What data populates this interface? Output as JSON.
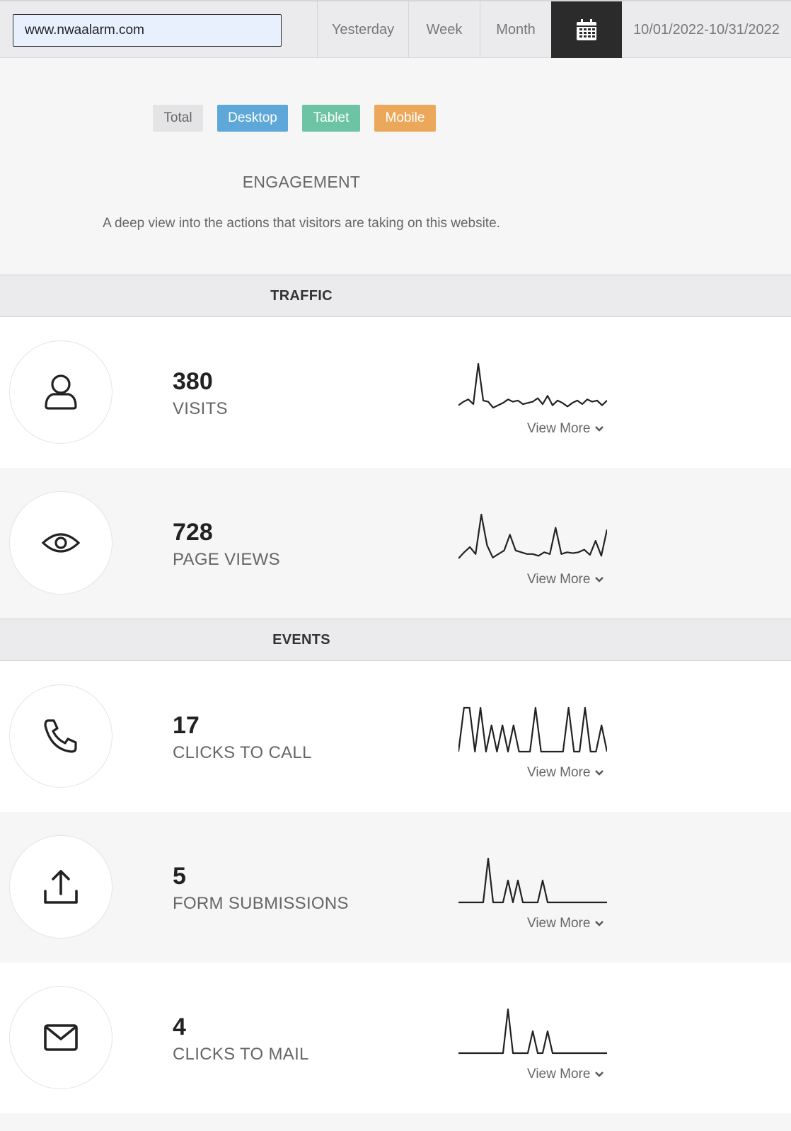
{
  "toolbar": {
    "site": "www.nwaalarm.com",
    "ranges": [
      "Yesterday",
      "Week",
      "Month"
    ],
    "date_range": "10/01/2022-10/31/2022"
  },
  "filters": [
    {
      "label": "Total",
      "bg": "#e4e4e6",
      "fg": "#666666"
    },
    {
      "label": "Desktop",
      "bg": "#5ea8d9",
      "fg": "#ffffff"
    },
    {
      "label": "Tablet",
      "bg": "#6cc4a4",
      "fg": "#ffffff"
    },
    {
      "label": "Mobile",
      "bg": "#eba85a",
      "fg": "#ffffff"
    }
  ],
  "engagement": {
    "title": "ENGAGEMENT",
    "description": "A deep view into the actions that visitors are taking on this website."
  },
  "sections": {
    "traffic": "TRAFFIC",
    "events": "EVENTS"
  },
  "metrics": {
    "visits": {
      "value": "380",
      "label": "VISITS",
      "icon": "user-icon",
      "series": [
        5,
        8,
        10,
        6,
        40,
        9,
        8,
        3,
        5,
        7,
        10,
        8,
        9,
        6,
        7,
        8,
        11,
        6,
        13,
        5,
        9,
        7,
        4,
        7,
        9,
        6,
        10,
        8,
        9,
        5,
        9
      ]
    },
    "pageviews": {
      "value": "728",
      "label": "PAGE VIEWS",
      "icon": "eye-icon",
      "series": [
        5,
        12,
        18,
        10,
        55,
        20,
        6,
        10,
        14,
        32,
        14,
        12,
        10,
        10,
        8,
        12,
        10,
        40,
        10,
        12,
        11,
        12,
        15,
        9,
        25,
        8,
        38
      ]
    },
    "calls": {
      "value": "17",
      "label": "CLICKS TO CALL",
      "icon": "phone-icon",
      "series": [
        0,
        1,
        1,
        0,
        1,
        0,
        0.6,
        0,
        0.6,
        0,
        0.6,
        0,
        0,
        0,
        1,
        0,
        0,
        0,
        0,
        0,
        1,
        0,
        0,
        1,
        0,
        0,
        0.6,
        0
      ]
    },
    "forms": {
      "value": "5",
      "label": "FORM SUBMISSIONS",
      "icon": "upload-icon",
      "series": [
        0,
        0,
        0,
        0,
        0,
        0,
        1,
        0,
        0,
        0,
        0.5,
        0,
        0.5,
        0,
        0,
        0,
        0,
        0.5,
        0,
        0,
        0,
        0,
        0,
        0,
        0,
        0,
        0,
        0,
        0,
        0,
        0
      ]
    },
    "mail": {
      "value": "4",
      "label": "CLICKS TO MAIL",
      "icon": "mail-icon",
      "series": [
        0,
        0,
        0,
        0,
        0,
        0,
        0,
        0,
        0,
        0,
        1,
        0,
        0,
        0,
        0,
        0.5,
        0,
        0,
        0.5,
        0,
        0,
        0,
        0,
        0,
        0,
        0,
        0,
        0,
        0,
        0,
        0
      ]
    }
  },
  "view_more": "View More"
}
